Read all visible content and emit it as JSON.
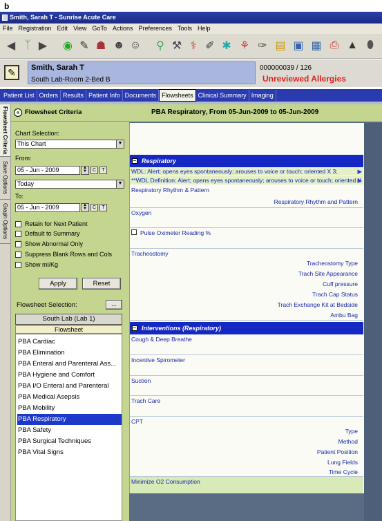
{
  "figure_label": "b",
  "window": {
    "title": "Smith, Sarah T - Sunrise Acute Care"
  },
  "menu": [
    "File",
    "Registration",
    "Edit",
    "View",
    "GoTo",
    "Actions",
    "Preferences",
    "Tools",
    "Help"
  ],
  "toolbar_icons": [
    "back-arrow-icon",
    "people-icon",
    "forward-arrow-icon",
    "refresh-icon",
    "edit-orders-icon",
    "patient-list-icon",
    "group-icon",
    "vitals-icon",
    "search-icon",
    "tools-icon",
    "caduceus-icon",
    "pencil-icon",
    "star-icon",
    "figure-icon",
    "syringe-icon",
    "chart-icon",
    "monitor-icon",
    "clipboard-icon",
    "print-icon",
    "warning-icon",
    "pill-icon"
  ],
  "patient": {
    "name": "Smith, Sarah T",
    "location": "South Lab-Room 2-Bed B",
    "mrn": "000000039 / 126",
    "allergy_status": "Unreviewed Allergies",
    "allergy_color": "#e02020"
  },
  "tabs": [
    {
      "label": "Patient List"
    },
    {
      "label": "Orders"
    },
    {
      "label": "Results"
    },
    {
      "label": "Patient Info"
    },
    {
      "label": "Documents"
    },
    {
      "label": "Flowsheets",
      "active": true
    },
    {
      "label": "Clinical Summary"
    },
    {
      "label": "Imaging"
    }
  ],
  "side_tabs": [
    "Flowsheet Criteria",
    "Save Options",
    "Graph Options"
  ],
  "criteria": {
    "title": "Flowsheet Criteria",
    "chart_selection_label": "Chart Selection:",
    "chart_selection_value": "This Chart",
    "from_label": "From:",
    "from_date": "05 - Jun - 2009",
    "from_relative": "Today",
    "to_label": "To:",
    "to_date": "05 - Jun - 2009",
    "btn_c": "C",
    "btn_t": "T",
    "checkboxes": [
      "Retain for Next Patient",
      "Default to Summary",
      "Show Abnormal Only",
      "Suppress Blank Rows and Cols",
      "Show ml/Kg"
    ],
    "apply_label": "Apply",
    "reset_label": "Reset",
    "flowsheet_selection_label": "Flowsheet Selection:",
    "more_label": "...",
    "lab_button": "South Lab (Lab 1)",
    "flowsheet_column": "Flowsheet",
    "flowsheets": [
      "PBA Cardiac",
      "PBA Elimination",
      "PBA Enteral and Parenteral Ass...",
      "PBA Hygiene and Comfort",
      "PBA I/O Enteral and Parenteral",
      "PBA Medical Asepsis",
      "PBA Mobility",
      "PBA Respiratory",
      "PBA Safety",
      "PBA Surgical Techniques",
      "PBA Vital Signs"
    ],
    "selected_flowsheet": "PBA Respiratory"
  },
  "main": {
    "header": "PBA Respiratory, From 05-Jun-2009 to 05-Jun-2009",
    "respiratory_section": "Respiratory",
    "wdl1": "WDL: Alert; opens eyes spontaneously; arouses to voice or touch; oriented X 3;",
    "wdl2": "**WDL Definition: Alert; opens eyes spontaneously; arouses to voice or touch; oriented X 3",
    "rows": {
      "rhythm": "Respiratory Rhythm & Pattern",
      "rhythm_sub": "Respiratory Rhythm and Pattern",
      "oxygen": "Oxygen",
      "pulse_ox": "Pulse Oximeter Reading %",
      "tracheostomy": "Tracheostomy",
      "trach_type": "Tracheostomy Type",
      "trach_site": "Trach Site Appearance",
      "cuff": "Cuff pressure",
      "cap": "Trach Cap Status",
      "kit": "Trach Exchange Kit at Bedside",
      "ambu": "Ambu Bag"
    },
    "interventions_section": "Interventions (Respiratory)",
    "irows": {
      "cough": "Cough & Deep Breathe",
      "spiro": "Incentive Spirometer",
      "suction": "Suction",
      "trachcare": "Trach Care",
      "cpt": "CPT",
      "type": "Type",
      "method": "Method",
      "position": "Patient Position",
      "lungs": "Lung Fields",
      "cycle": "Time Cycle",
      "minimize": "Minimize O2 Consumption"
    }
  }
}
